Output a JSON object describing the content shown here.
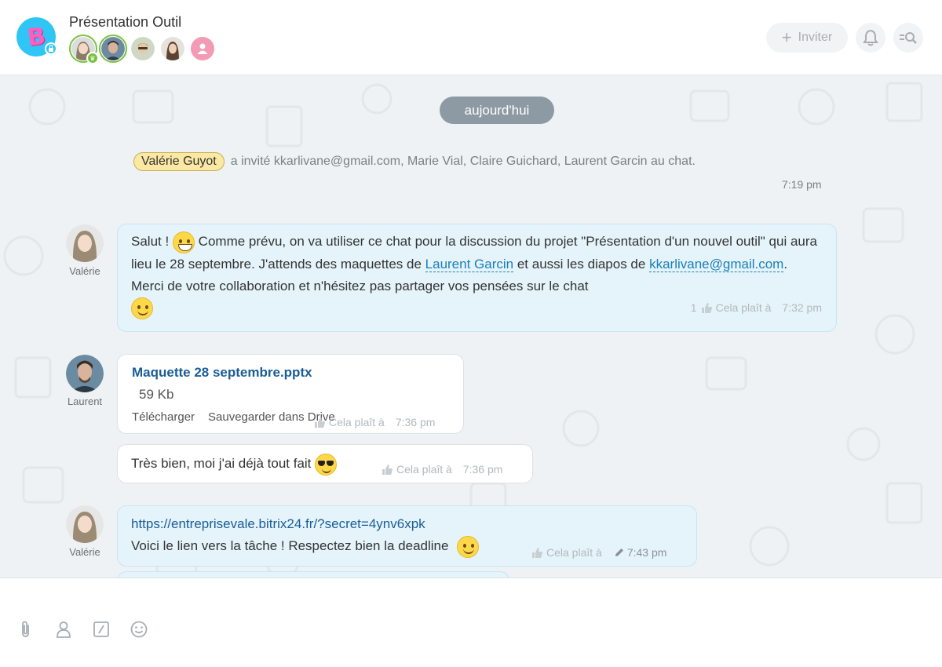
{
  "header": {
    "title": "Présentation Outil",
    "avatar_letter": "B",
    "invite_label": "Inviter",
    "members": [
      "owner-valerie",
      "laurent",
      "marie",
      "claire",
      "empty-user"
    ]
  },
  "messages": {
    "date_label": "aujourd'hui",
    "system": {
      "author": "Valérie Guyot",
      "text": "a invité kkarlivane@gmail.com, Marie Vial, Claire Guichard, Laurent Garcin au chat.",
      "time": "7:19 pm"
    },
    "m1": {
      "author": "Valérie",
      "part1": "Salut !",
      "part2": "Comme prévu, on va utiliser ce chat pour la discussion du projet \"Présentation d'un nouvel outil\" qui aura lieu le 28 septembre. J'attends des maquettes de",
      "mention1": "Laurent Garcin",
      "part3": "et aussi les diapos de",
      "mention2": "kkarlivane@gmail.com",
      "part4": ". Merci de votre collaboration et n'hésitez pas partager vos pensées sur le chat",
      "like_count": "1",
      "like_label": "Cela plaît à",
      "time": "7:32 pm"
    },
    "m2": {
      "author": "Laurent",
      "file_name": "Maquette 28 septembre.pptx",
      "file_size": "59 Kb",
      "download": "Télécharger",
      "save_drive": "Sauvegarder dans Drive",
      "like_label": "Cela plaît à",
      "time": "7:36 pm"
    },
    "m3": {
      "text": "Très bien, moi j'ai déjà tout fait",
      "like_label": "Cela plaît à",
      "time": "7:36 pm"
    },
    "m4": {
      "author": "Valérie",
      "link": "https://entreprisevale.bitrix24.fr/?secret=4ynv6xpk",
      "text": "Voici le lien vers la tâche ! Respectez bien la deadline",
      "like_label": "Cela plaît à",
      "time": "7:43 pm"
    }
  },
  "input": {
    "tools": [
      "attach-icon",
      "mention-user-icon",
      "command-icon",
      "emoji-icon"
    ]
  },
  "colors": {
    "accent": "#2fc6f6",
    "link": "#1a5d96",
    "bubble_blue": "#e5f4fb",
    "owner_green": "#7ac143"
  }
}
